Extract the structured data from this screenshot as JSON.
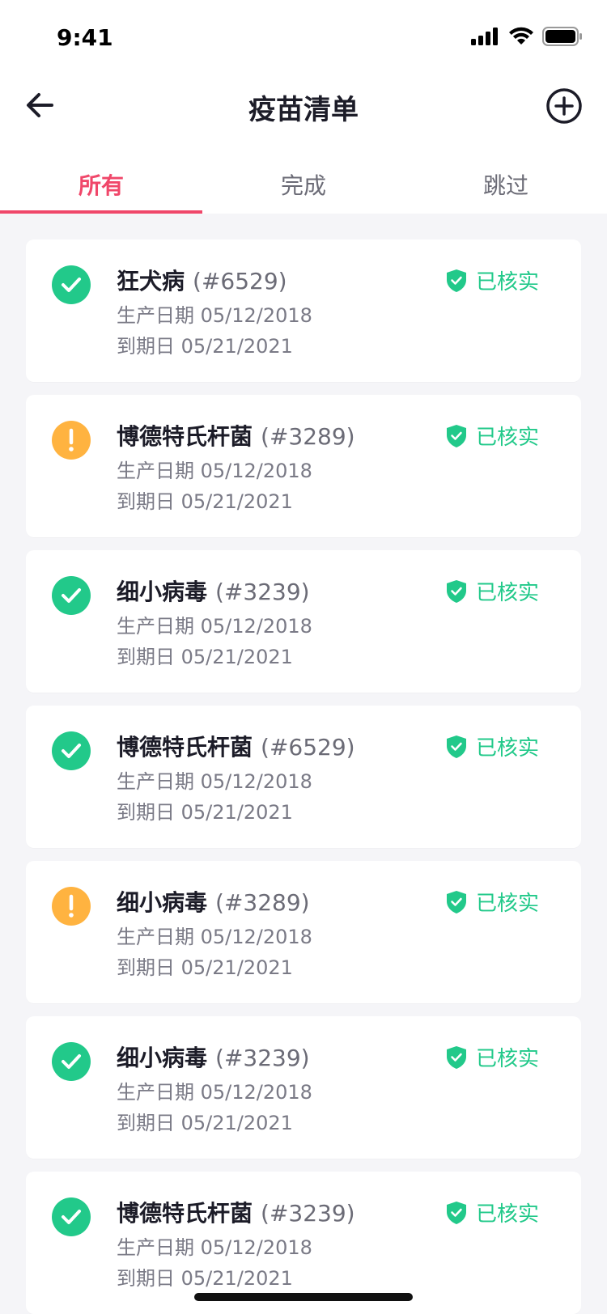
{
  "status_bar": {
    "time": "9:41"
  },
  "header": {
    "title": "疫苗清单"
  },
  "tabs": [
    {
      "label": "所有",
      "active": true
    },
    {
      "label": "完成",
      "active": false
    },
    {
      "label": "跳过",
      "active": false
    }
  ],
  "vaccines": [
    {
      "status": "done",
      "name": "狂犬病",
      "code": "(#6529)",
      "production": "生产日期 05/12/2018",
      "expiry": "到期日 05/21/2021",
      "verified": "已核实"
    },
    {
      "status": "skipped",
      "name": "博德特氏杆菌",
      "code": "(#3289)",
      "production": "生产日期 05/12/2018",
      "expiry": "到期日 05/21/2021",
      "verified": "已核实"
    },
    {
      "status": "done",
      "name": "细小病毒",
      "code": "(#3239)",
      "production": "生产日期 05/12/2018",
      "expiry": "到期日 05/21/2021",
      "verified": "已核实"
    },
    {
      "status": "done",
      "name": "博德特氏杆菌",
      "code": "(#6529)",
      "production": "生产日期 05/12/2018",
      "expiry": "到期日 05/21/2021",
      "verified": "已核实"
    },
    {
      "status": "skipped",
      "name": "细小病毒",
      "code": "(#3289)",
      "production": "生产日期 05/12/2018",
      "expiry": "到期日 05/21/2021",
      "verified": "已核实"
    },
    {
      "status": "done",
      "name": "细小病毒",
      "code": "(#3239)",
      "production": "生产日期 05/12/2018",
      "expiry": "到期日 05/21/2021",
      "verified": "已核实"
    },
    {
      "status": "done",
      "name": "博德特氏杆菌",
      "code": "(#3239)",
      "production": "生产日期 05/12/2018",
      "expiry": "到期日 05/21/2021",
      "verified": "已核实"
    }
  ],
  "colors": {
    "accent": "#F0476A",
    "success": "#22C98A",
    "warning": "#FFB340",
    "text_primary": "#1C1C28",
    "text_secondary": "#7A7A86",
    "background": "#F5F5F8"
  },
  "icons": {
    "back": "arrow-left-icon",
    "add": "plus-circle-icon",
    "done": "check-circle-icon",
    "skipped": "exclamation-circle-icon",
    "verified": "shield-check-icon"
  }
}
